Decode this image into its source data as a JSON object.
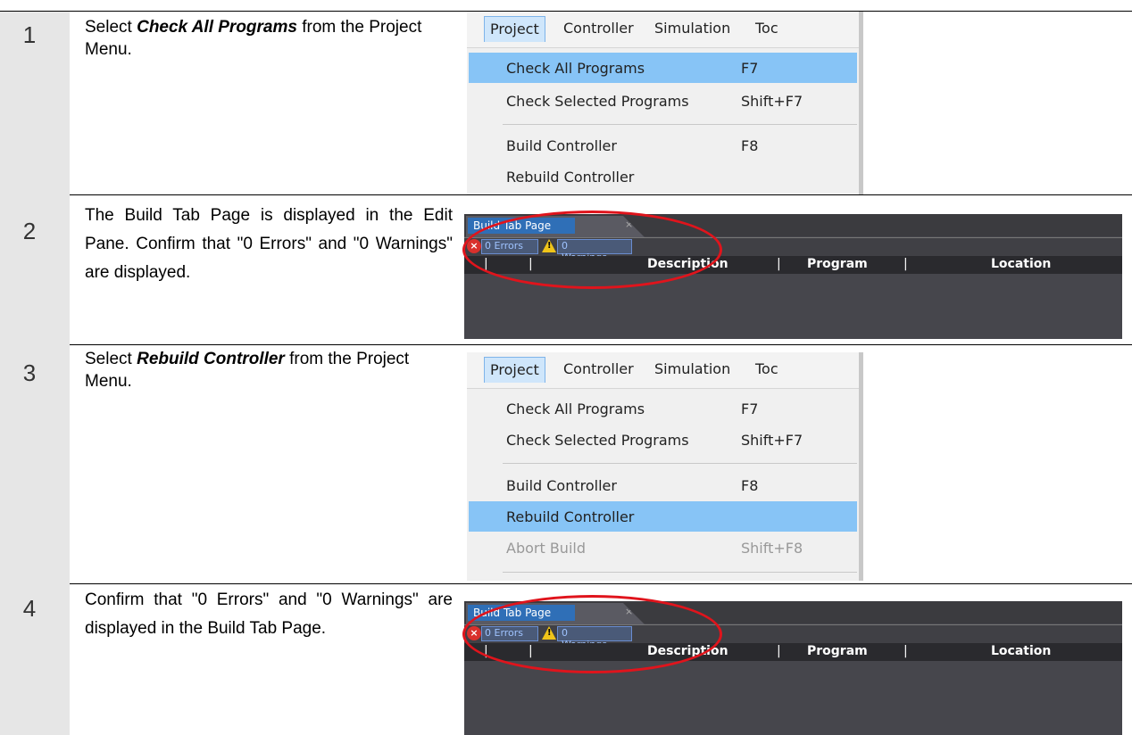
{
  "steps": [
    {
      "num": "1",
      "text_prefix": "Select ",
      "text_bold": "Check All Programs",
      "text_suffix": " from the Project Menu."
    },
    {
      "num": "2",
      "text": "The Build Tab Page is displayed in the Edit Pane. Confirm that \"0 Errors\" and \"0 Warnings\" are displayed."
    },
    {
      "num": "3",
      "text_prefix": "Select ",
      "text_bold": "Rebuild Controller",
      "text_suffix": " from the Project Menu."
    },
    {
      "num": "4",
      "text": "Confirm that \"0 Errors\" and \"0 Warnings\" are displayed in the Build Tab Page."
    }
  ],
  "menu": {
    "bar": [
      "Project",
      "Controller",
      "Simulation",
      "Toc"
    ],
    "items": {
      "check_all": {
        "label": "Check All Programs",
        "shortcut": "F7"
      },
      "check_selected": {
        "label": "Check Selected Programs",
        "shortcut": "Shift+F7"
      },
      "build": {
        "label": "Build Controller",
        "shortcut": "F8"
      },
      "rebuild": {
        "label": "Rebuild Controller",
        "shortcut": ""
      },
      "abort": {
        "label": "Abort Build",
        "shortcut": "Shift+F8"
      }
    }
  },
  "build_tab": {
    "title": "Build Tab Page",
    "close": "×",
    "errors": "0 Errors",
    "warnings": "0 Warnings",
    "columns": [
      "Description",
      "Program",
      "Location"
    ]
  },
  "colors": {
    "highlight": "#87c4f6",
    "ellipse": "#e0141c",
    "error": "#d9302c",
    "warning": "#f0c419"
  },
  "icons": [
    "error-icon",
    "warning-icon",
    "close-icon"
  ]
}
